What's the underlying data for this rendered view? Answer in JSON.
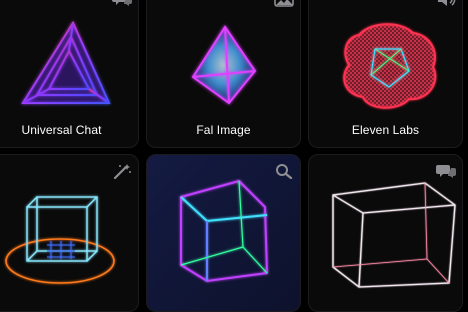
{
  "cards": [
    {
      "label": "Universal Chat",
      "icon": "chat-bubbles-icon"
    },
    {
      "label": "Fal Image",
      "icon": "image-icon"
    },
    {
      "label": "Eleven Labs",
      "icon": "speaker-icon"
    },
    {
      "label": "",
      "icon": "magic-wand-icon"
    },
    {
      "label": "",
      "icon": "search-icon"
    },
    {
      "label": "",
      "icon": "chat-bubbles-icon"
    }
  ],
  "colors": {
    "background": "#000000",
    "card": "#0a0a0a",
    "border": "#1c1c1e",
    "icon": "#8e8e93",
    "label": "#ffffff"
  }
}
